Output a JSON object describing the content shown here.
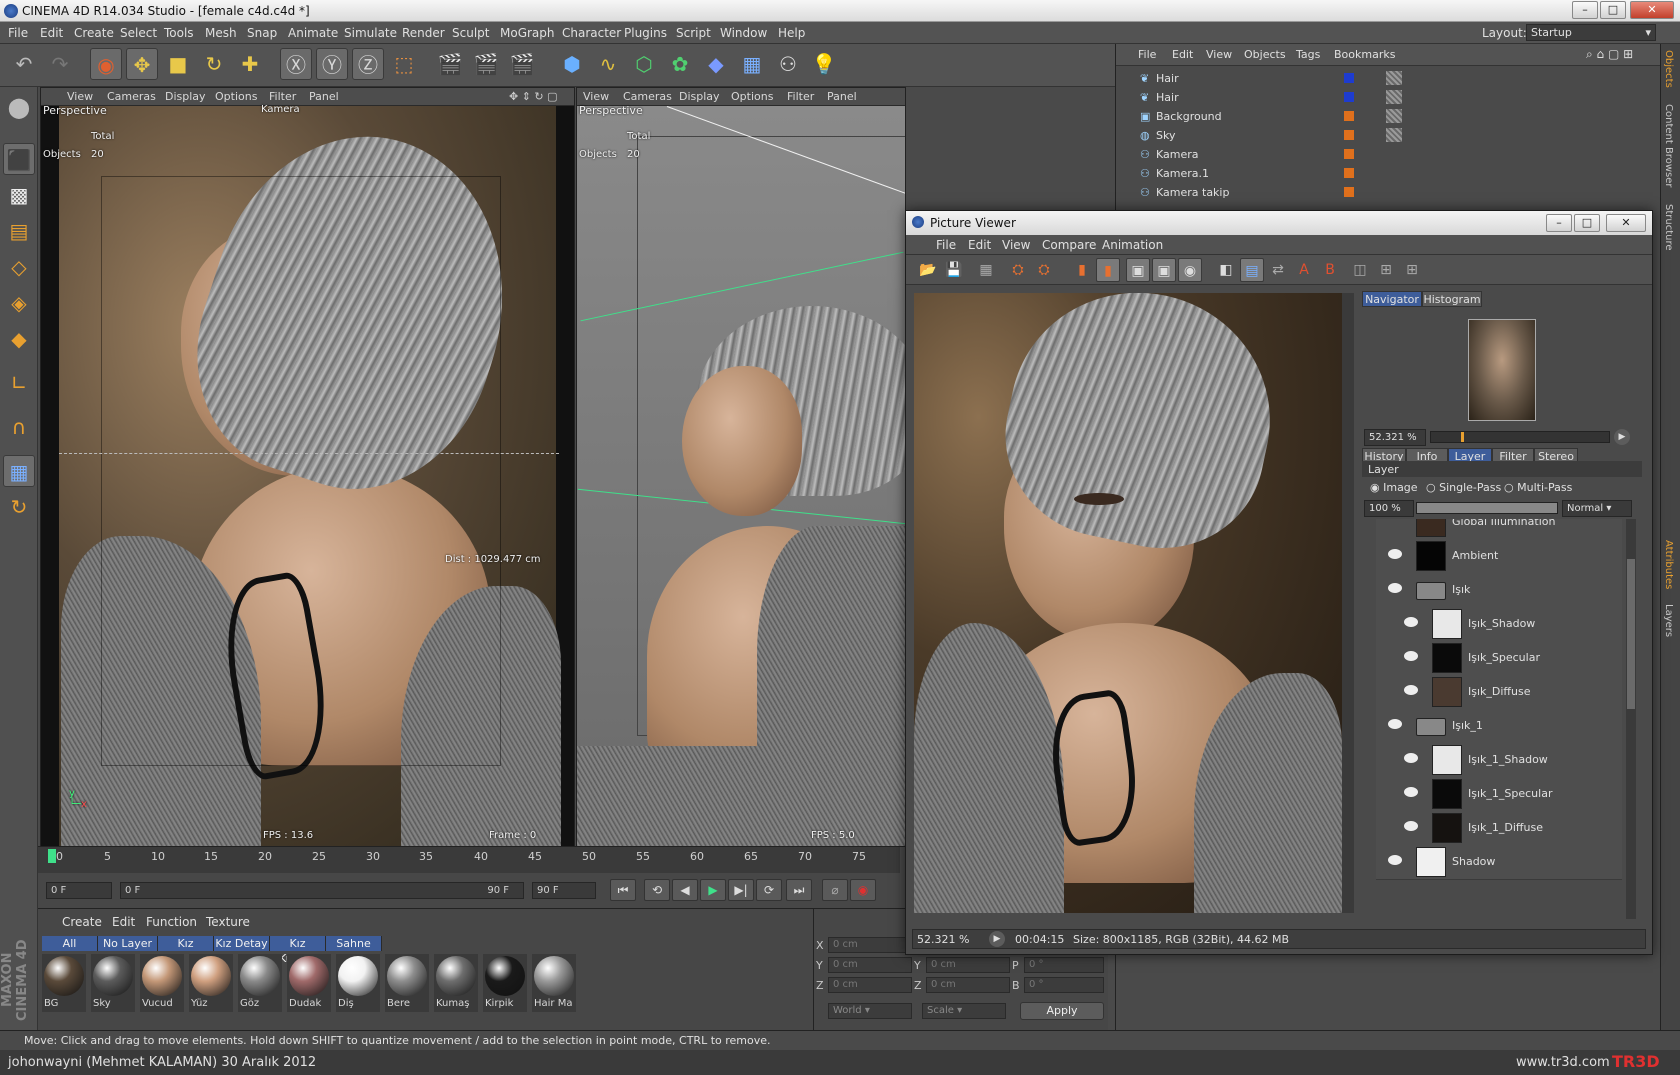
{
  "window": {
    "title": "CINEMA 4D R14.034 Studio - [female c4d.c4d *]"
  },
  "menubar": {
    "items": [
      "File",
      "Edit",
      "Create",
      "Select",
      "Tools",
      "Mesh",
      "Snap",
      "Animate",
      "Simulate",
      "Render",
      "Sculpt",
      "MoGraph",
      "Character",
      "Plugins",
      "Script",
      "Window",
      "Help"
    ],
    "layout_label": "Layout:",
    "layout_value": "Startup"
  },
  "viewport_menu": [
    "View",
    "Cameras",
    "Display",
    "Options",
    "Filter",
    "Panel"
  ],
  "viewport1": {
    "name": "Perspective",
    "camera": "Kamera",
    "total_label": "Total",
    "objects_label": "Objects",
    "objects_value": "20",
    "dist": "Dist : 1029.477 cm",
    "fps": "FPS : 13.6",
    "frame": "Frame : 0"
  },
  "viewport2": {
    "name": "Perspective",
    "total_label": "Total",
    "objects_label": "Objects",
    "objects_value": "20",
    "fps": "FPS : 5.0"
  },
  "timeline": {
    "ticks": [
      "0",
      "5",
      "10",
      "15",
      "20",
      "25",
      "30",
      "35",
      "40",
      "45",
      "50",
      "55",
      "60",
      "65",
      "70",
      "75"
    ]
  },
  "transport": {
    "current": "0 F",
    "range_start": "0 F",
    "range_end": "90 F",
    "end": "90 F"
  },
  "material_manager": {
    "menu": [
      "Create",
      "Edit",
      "Function",
      "Texture"
    ],
    "tabs": [
      "All",
      "No Layer",
      "Kız",
      "Kız Detay",
      "Kız Kumaş",
      "Sahne"
    ],
    "materials": [
      {
        "name": "BG",
        "color": "#5a4a3a"
      },
      {
        "name": "Sky",
        "color": "#5c5c5c"
      },
      {
        "name": "Vucud",
        "color": "#c49878"
      },
      {
        "name": "Yüz",
        "color": "#d0a080"
      },
      {
        "name": "Göz",
        "color": "#8a8a8a"
      },
      {
        "name": "Dudak",
        "color": "#a06a6a"
      },
      {
        "name": "Diş",
        "color": "#f2f2f2"
      },
      {
        "name": "Bere",
        "color": "#8e8e8e"
      },
      {
        "name": "Kumaş",
        "color": "#6e6e6e"
      },
      {
        "name": "Kirpik",
        "color": "#1a1a1a"
      },
      {
        "name": "Hair Ma",
        "color": "#9a9a9a"
      }
    ]
  },
  "coordinates": {
    "x": "0 cm",
    "y": "0 cm",
    "z": "0 cm",
    "sy": "0 cm",
    "sz": "0 cm",
    "p": "0 °",
    "b": "0 °",
    "world": "World",
    "scale": "Scale",
    "apply": "Apply"
  },
  "object_manager": {
    "menu": [
      "File",
      "Edit",
      "View",
      "Objects",
      "Tags",
      "Bookmarks"
    ],
    "objects": [
      "Hair",
      "Hair",
      "Background",
      "Sky",
      "Kamera",
      "Kamera.1",
      "Kamera takip"
    ]
  },
  "right_tabs": [
    "Objects",
    "Content Browser",
    "Structure",
    "Attributes",
    "Layers"
  ],
  "picture_viewer": {
    "title": "Picture Viewer",
    "menu": [
      "File",
      "Edit",
      "View",
      "Compare",
      "Animation"
    ],
    "nav_tabs": [
      "Navigator",
      "Histogram"
    ],
    "zoom": "52.321 %",
    "info_tabs": [
      "History",
      "Info",
      "Layer",
      "Filter",
      "Stereo"
    ],
    "layer_heading": "Layer",
    "modes": [
      "Image",
      "Single-Pass",
      "Multi-Pass"
    ],
    "opacity": "100 %",
    "blend": "Normal",
    "layers": [
      {
        "name": "Global Illumination",
        "indent": 0,
        "folder": false,
        "thumb": "#3a2a20"
      },
      {
        "name": "Ambient",
        "indent": 0,
        "folder": false,
        "thumb": "#050505"
      },
      {
        "name": "Işık",
        "indent": 0,
        "folder": true,
        "thumb": "#888"
      },
      {
        "name": "Işık_Shadow",
        "indent": 1,
        "folder": false,
        "thumb": "#e8e8e8"
      },
      {
        "name": "Işık_Specular",
        "indent": 1,
        "folder": false,
        "thumb": "#0a0a0a"
      },
      {
        "name": "Işık_Diffuse",
        "indent": 1,
        "folder": false,
        "thumb": "#4a3a30"
      },
      {
        "name": "Işık_1",
        "indent": 0,
        "folder": true,
        "thumb": "#888"
      },
      {
        "name": "Işık_1_Shadow",
        "indent": 1,
        "folder": false,
        "thumb": "#e8e8e8"
      },
      {
        "name": "Işık_1_Specular",
        "indent": 1,
        "folder": false,
        "thumb": "#0a0a0a"
      },
      {
        "name": "Işık_1_Diffuse",
        "indent": 1,
        "folder": false,
        "thumb": "#151210"
      },
      {
        "name": "Shadow",
        "indent": 0,
        "folder": false,
        "thumb": "#f0f0f0"
      }
    ],
    "status_zoom": "52.321 %",
    "time": "00:04:15",
    "size": "Size: 800x1185, RGB (32Bit), 44.62 MB"
  },
  "statusbar": {
    "text": "Move: Click and drag to move elements. Hold down SHIFT to quantize movement / add to the selection in point mode, CTRL to remove."
  },
  "footer": {
    "author": "johonwayni (Mehmet KALAMAN)  30 Aralık 2012",
    "site": "www.tr3d.com",
    "logo": "TR3D"
  },
  "branding": {
    "maxon": "MAXON CINEMA 4D"
  }
}
